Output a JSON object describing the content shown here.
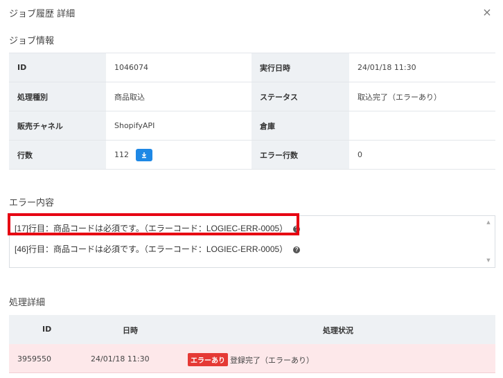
{
  "modal": {
    "title": "ジョブ履歴 詳細",
    "close_label": "×"
  },
  "job_info": {
    "section_title": "ジョブ情報",
    "rows": [
      {
        "label_left": "ID",
        "value_left": "1046074",
        "label_right": "実行日時",
        "value_right": "24/01/18 11:30"
      },
      {
        "label_left": "処理種別",
        "value_left": "商品取込",
        "label_right": "ステータス",
        "value_right": "取込完了（エラーあり）"
      },
      {
        "label_left": "販売チャネル",
        "value_left": "ShopifyAPI",
        "label_right": "倉庫",
        "value_right": ""
      },
      {
        "label_left": "行数",
        "value_left": "112",
        "label_right": "エラー行数",
        "value_right": "0"
      }
    ],
    "download_icon": "download-icon"
  },
  "errors": {
    "section_title": "エラー内容",
    "lines": [
      "[17]行目：商品コードは必須です。（エラーコード：LOGIEC-ERR-0005）",
      "[46]行目：商品コードは必須です。（エラーコード：LOGIEC-ERR-0005）"
    ],
    "help_icon": "?"
  },
  "details": {
    "section_title": "処理詳細",
    "headers": [
      "ID",
      "日時",
      "処理状況"
    ],
    "rows": [
      {
        "id": "3959550",
        "datetime": "24/01/18 11:30",
        "badge": "エラーあり",
        "status": "登録完了（エラーあり）"
      }
    ]
  },
  "colors": {
    "accent": "#1e88e5",
    "highlight_border": "#e60012",
    "error_badge": "#e53935",
    "error_row_bg": "#fde8ea",
    "label_bg": "#eef1f4"
  }
}
